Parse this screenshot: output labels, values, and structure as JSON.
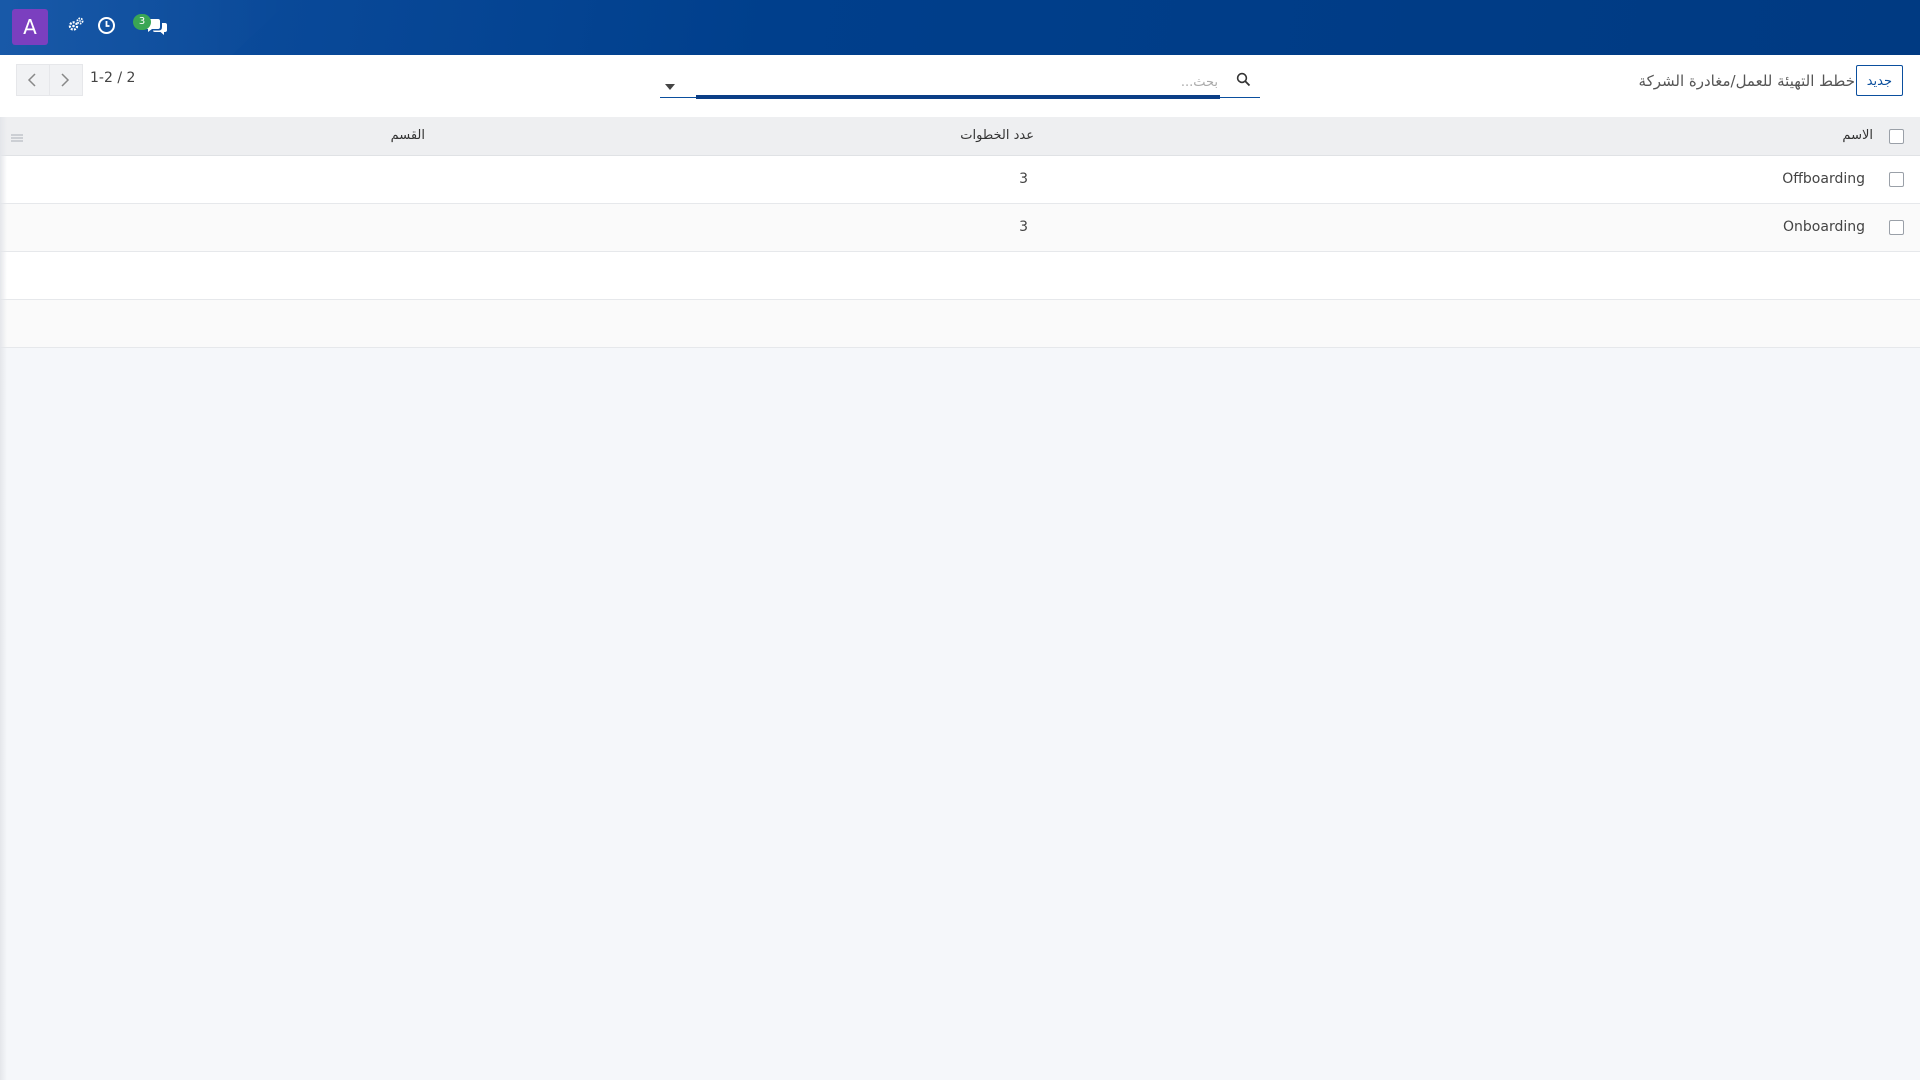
{
  "navbar": {
    "avatar_letter": "A",
    "icons": [
      "settings-gears-icon",
      "activity-clock-icon",
      "messages-chat-icon"
    ],
    "messages_badge": "3",
    "brand_color": "#003f8c"
  },
  "control_panel": {
    "new_label": "جديد",
    "breadcrumb": "خطط التهيئة للعمل/مغادرة الشركة",
    "search": {
      "placeholder": "بحث...",
      "value": ""
    },
    "pager": {
      "counter": "1-2 / 2"
    }
  },
  "table": {
    "headers": {
      "name": "الاسم",
      "steps": "عدد الخطوات",
      "department": "القسم"
    },
    "rows": [
      {
        "name": "Offboarding",
        "steps": "3",
        "department": ""
      },
      {
        "name": "Onboarding",
        "steps": "3",
        "department": ""
      }
    ]
  }
}
